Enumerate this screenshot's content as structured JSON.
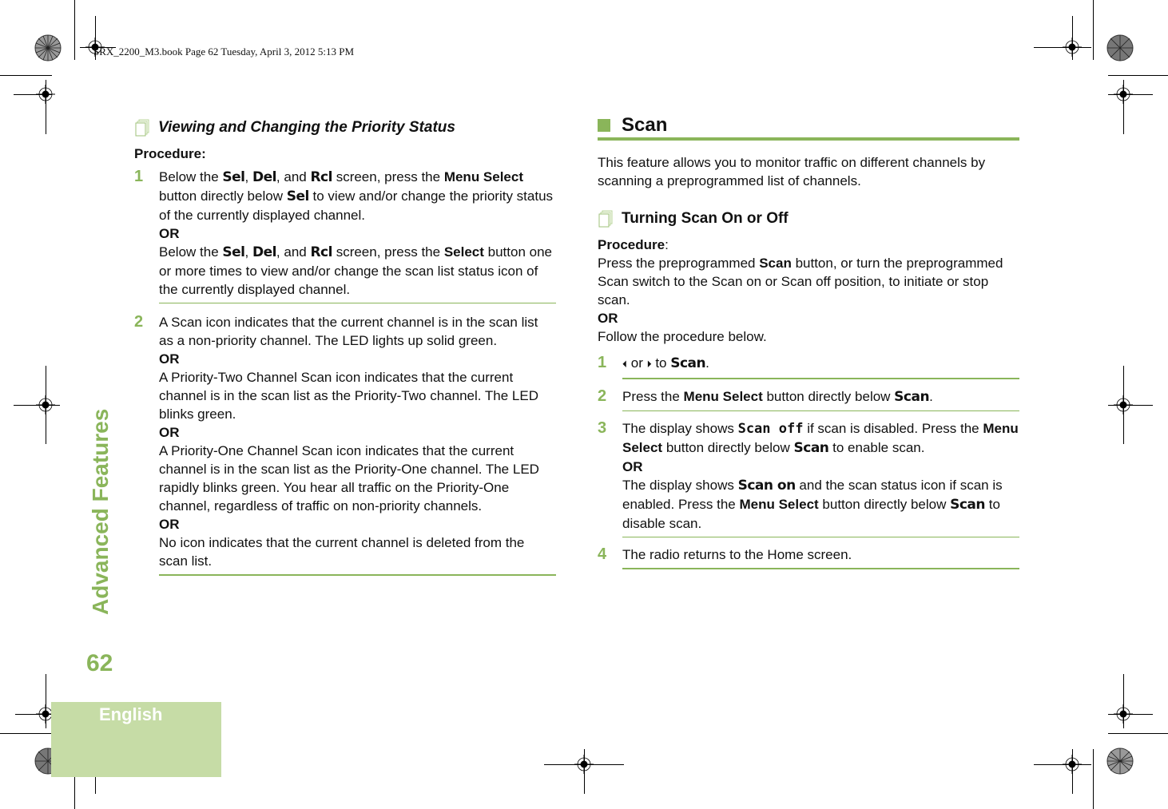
{
  "slug": "SRX_2200_M3.book  Page 62  Tuesday, April 3, 2012  5:13 PM",
  "side_title": "Advanced Features",
  "page_number": "62",
  "language_tab": "English",
  "colors": {
    "accent": "#8ab55a",
    "tab_bg": "#c6dca6"
  },
  "left": {
    "heading": "Viewing and Changing the Priority Status",
    "procedure_label": "Procedure:",
    "steps": [
      {
        "num": "1",
        "t1": "Below the ",
        "k1": "Sel",
        "t2": ", ",
        "k2": "Del",
        "t3": ", and ",
        "k3": "Rcl",
        "t4": " screen, press the ",
        "b1": "Menu Select",
        "t5": " button directly below ",
        "k4": "Sel",
        "t6": " to view and/or change the priority status of the currently displayed channel.",
        "or": "OR",
        "u1": "Below the ",
        "uk1": "Sel",
        "u2": ", ",
        "uk2": "Del",
        "u3": ", and ",
        "uk3": "Rcl",
        "u4": " screen, press the ",
        "ub1": "Select",
        "u5": " button one or more times to view and/or change the scan list status icon of the currently displayed channel."
      },
      {
        "num": "2",
        "p1": "A Scan icon indicates that the current channel is in the scan list as a non-priority channel. The LED lights up solid green.",
        "or1": "OR",
        "p2": "A Priority-Two Channel Scan icon indicates that the current channel is in the scan list as the Priority-Two channel. The LED blinks green.",
        "or2": "OR",
        "p3": "A Priority-One Channel Scan icon indicates that the current channel is in the scan list as the Priority-One channel. The LED rapidly blinks green. You hear all traffic on the Priority-One channel, regardless of traffic on non-priority channels.",
        "or3": "OR",
        "p4": "No icon indicates that the current channel is deleted from the scan list."
      }
    ]
  },
  "right": {
    "section_title": "Scan",
    "intro": "This feature allows you to monitor traffic on different channels by scanning a preprogrammed list of channels.",
    "sub_heading": "Turning Scan On or Off",
    "procedure_label": "Procedure",
    "procedure_colon": ":",
    "pre1": "Press the preprogrammed ",
    "pre_b": "Scan",
    "pre2": " button, or turn the preprogrammed Scan switch to the Scan on or Scan off position, to initiate or stop scan.",
    "or": "OR",
    "follow": "Follow the procedure below.",
    "steps": [
      {
        "num": "1",
        "left_arrow": "⏴",
        "or": " or ",
        "right_arrow": "⏵",
        "to": " to ",
        "k": "Scan",
        "end": "."
      },
      {
        "num": "2",
        "t1": "Press the ",
        "b1": "Menu Select",
        "t2": " button directly below ",
        "k": "Scan",
        "end": "."
      },
      {
        "num": "3",
        "t1": "The display shows ",
        "k1": "Scan off",
        "t2": " if scan is disabled. Press the ",
        "b1": "Menu Select",
        "t3": " button directly below ",
        "k2": "Scan",
        "t4": " to enable scan.",
        "or": "OR",
        "u1": "The display shows ",
        "uk1": "Scan on",
        "u2": " and the scan status icon if scan is enabled. Press the ",
        "ub1": "Menu Select",
        "u3": " button directly below ",
        "uk2": "Scan",
        "u4": " to disable scan."
      },
      {
        "num": "4",
        "t1": "The radio returns to the Home screen."
      }
    ]
  }
}
